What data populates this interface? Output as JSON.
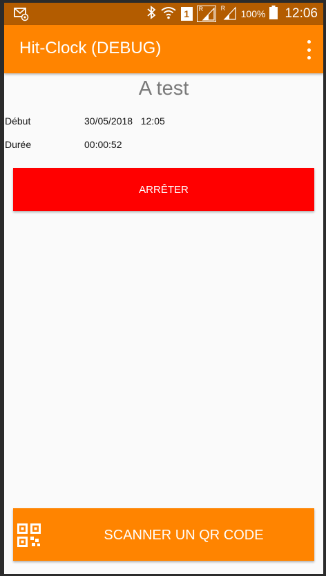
{
  "colors": {
    "status_bar": "#b35c00",
    "app_bar": "#ff8400",
    "stop_button": "#ff0000",
    "scan_button": "#ff8400",
    "background": "#fafafa"
  },
  "status_bar": {
    "icons": [
      "email-notification-icon",
      "bluetooth-icon",
      "wifi-icon",
      "sim-1-icon",
      "signal-roaming-icon",
      "signal-roaming-icon",
      "battery-icon"
    ],
    "sim_slot": "1",
    "roaming_label": "R",
    "battery_level": "100%",
    "time": "12:06"
  },
  "app_bar": {
    "title": "Hit-Clock (DEBUG)",
    "overflow_icon": "more-vert-icon"
  },
  "session": {
    "title": "A test",
    "start_label": "Début",
    "start_value": "30/05/2018   12:05",
    "duration_label": "Durée",
    "duration_value": "00:00:52"
  },
  "actions": {
    "stop_label": "ARRÊTER",
    "scan_label": "SCANNER UN QR CODE",
    "scan_icon": "qr-code-icon"
  }
}
